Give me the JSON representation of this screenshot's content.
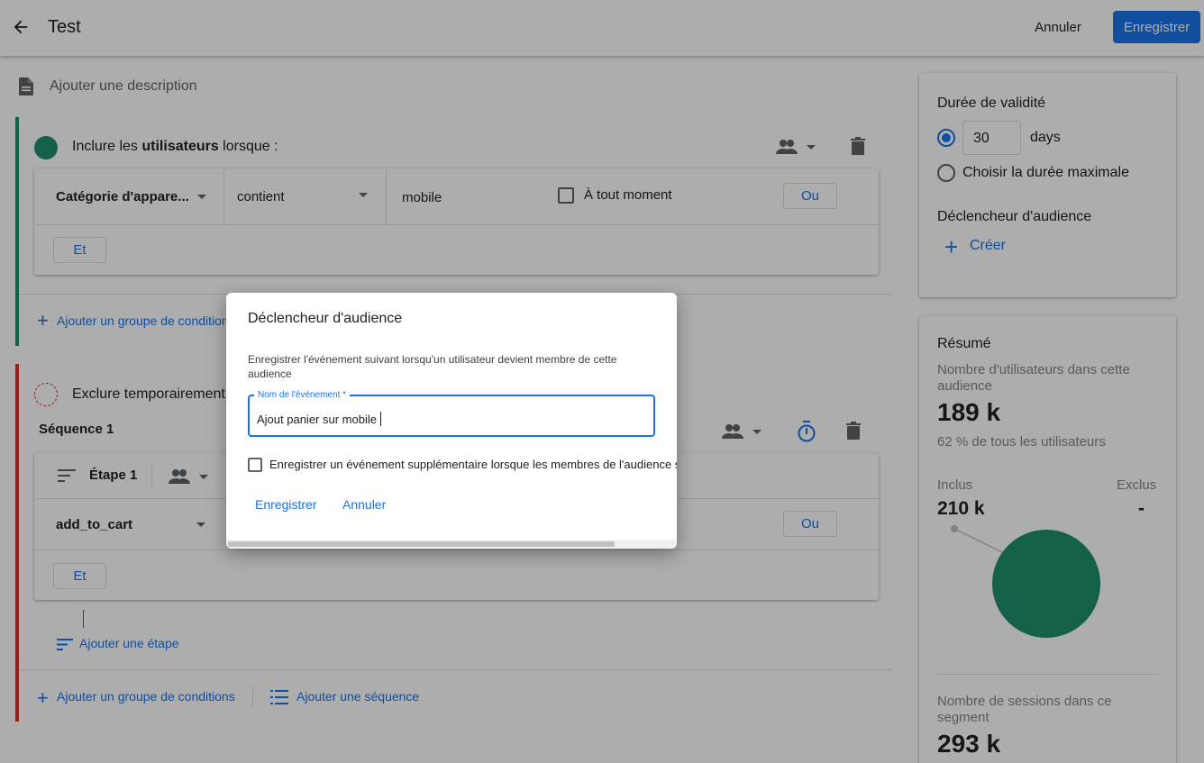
{
  "header": {
    "title": "Test",
    "cancel_label": "Annuler",
    "save_label": "Enregistrer"
  },
  "description": {
    "placeholder": "Ajouter une description"
  },
  "include_group": {
    "title_prefix": "Inclure les ",
    "title_bold": "utilisateurs",
    "title_suffix": " lorsque :",
    "condition": {
      "dimension": "Catégorie d'appare...",
      "operator": "contient",
      "value": "mobile",
      "checkbox_label": "À tout moment",
      "or_label": "Ou"
    },
    "and_label": "Et",
    "add_group_label": "Ajouter un groupe de conditions"
  },
  "exclude_group": {
    "title": "Exclure temporairement",
    "sequence_title": "Séquence 1",
    "step_label": "Étape 1",
    "event": "add_to_cart",
    "or_label": "Ou",
    "and_label": "Et",
    "add_step_label": "Ajouter une étape",
    "add_group_label": "Ajouter un groupe de conditions",
    "add_sequence_label": "Ajouter une séquence"
  },
  "validity": {
    "title": "Durée de validité",
    "days_value": "30",
    "days_label": "days",
    "max_label": "Choisir la durée maximale",
    "trigger_title": "Déclencheur d'audience",
    "create_label": "Créer"
  },
  "summary": {
    "title": "Résumé",
    "users_label": "Nombre d'utilisateurs dans cette audience",
    "users_value": "189 k",
    "users_pct": "62 % de tous les utilisateurs",
    "included_label": "Inclus",
    "included_value": "210 k",
    "excluded_label": "Exclus",
    "excluded_value": "-",
    "sessions_label": "Nombre de sessions dans ce segment",
    "sessions_value": "293 k",
    "pie_color": "#1e8e6e"
  },
  "dialog": {
    "title": "Déclencheur d'audience",
    "description": "Enregistrer l'événement suivant lorsqu'un utilisateur devient membre de cette audience",
    "field_label": "Nom de l'événement *",
    "field_value": "Ajout panier sur mobile",
    "checkbox_label": "Enregistrer un événement supplémentaire lorsque les membres de l'audience s",
    "save_label": "Enregistrer",
    "cancel_label": "Annuler"
  },
  "colors": {
    "accent": "#1a73e8",
    "include_green": "#1e8e6e",
    "exclude_red": "#d93025"
  }
}
